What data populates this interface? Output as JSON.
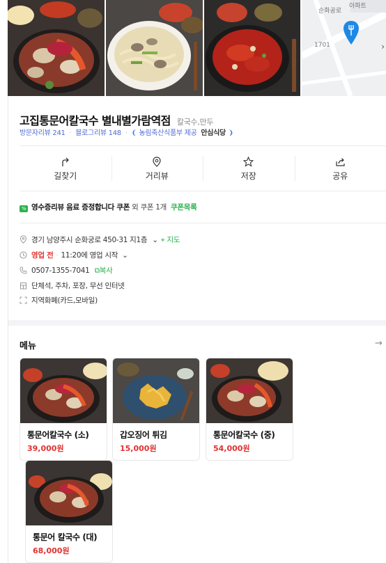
{
  "map": {
    "road_label": "순화공로",
    "building_label": "아파트",
    "lot_number": "1701",
    "next_icon": "chevron-right-icon"
  },
  "place": {
    "title": "고집통문어칼국수 별내별가람역점",
    "category": "칼국수,만두",
    "visitor_reviews": "방문자리뷰 241",
    "blog_reviews": "블로그리뷰 148",
    "certification": "농림축산식품부 제공",
    "badge": "안심식당"
  },
  "actions": [
    {
      "label": "길찾기",
      "icon": "directions-icon"
    },
    {
      "label": "거리뷰",
      "icon": "location-pin-icon"
    },
    {
      "label": "저장",
      "icon": "star-icon"
    },
    {
      "label": "공유",
      "icon": "share-icon"
    }
  ],
  "coupon": {
    "text": "영수증리뷰 음료 증정합니다 쿠폰",
    "extra": "외 쿠폰 1개",
    "link": "쿠폰목록"
  },
  "info": {
    "address": "경기 남양주시 순화궁로 450-31 지1층",
    "map_link": "지도",
    "status": "영업 전",
    "hours": "11:20에 영업 시작",
    "phone": "0507-1355-7041",
    "copy": "복사",
    "amenities": "단체석, 주차, 포장, 무선 인터넷",
    "payment": "지역화폐(카드,모바일)"
  },
  "menu": {
    "title": "메뉴",
    "items": [
      {
        "name": "통문어칼국수 (소)",
        "price": "39,000원"
      },
      {
        "name": "갑오징어 튀김",
        "price": "15,000원"
      },
      {
        "name": "통문어칼국수 (중)",
        "price": "54,000원"
      },
      {
        "name": "통문어 칼국수 (대)",
        "price": "68,000원"
      }
    ]
  },
  "colors": {
    "accent_green": "#2bb24c",
    "price_red": "#e0322f",
    "link_blue": "#4d6bd6",
    "map_pin": "#1e88e5"
  }
}
